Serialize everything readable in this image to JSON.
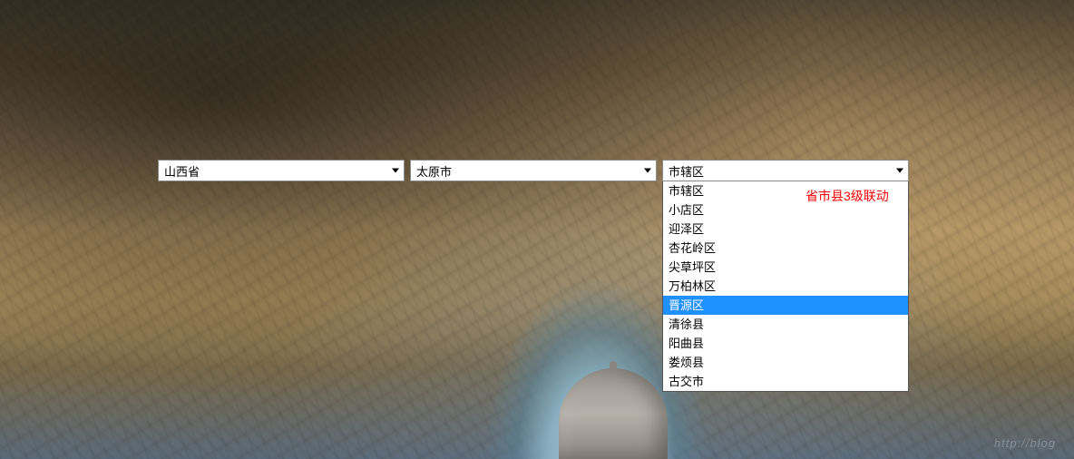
{
  "selects": {
    "province": {
      "selected": "山西省"
    },
    "city": {
      "selected": "太原市"
    },
    "district": {
      "selected": "市辖区",
      "options": [
        {
          "label": "市辖区",
          "highlighted": false
        },
        {
          "label": "小店区",
          "highlighted": false
        },
        {
          "label": "迎泽区",
          "highlighted": false
        },
        {
          "label": "杏花岭区",
          "highlighted": false
        },
        {
          "label": "尖草坪区",
          "highlighted": false
        },
        {
          "label": "万柏林区",
          "highlighted": false
        },
        {
          "label": "晋源区",
          "highlighted": true
        },
        {
          "label": "清徐县",
          "highlighted": false
        },
        {
          "label": "阳曲县",
          "highlighted": false
        },
        {
          "label": "娄烦县",
          "highlighted": false
        },
        {
          "label": "古交市",
          "highlighted": false
        }
      ]
    }
  },
  "annotation": "省市县3级联动",
  "watermark": "http://blog"
}
